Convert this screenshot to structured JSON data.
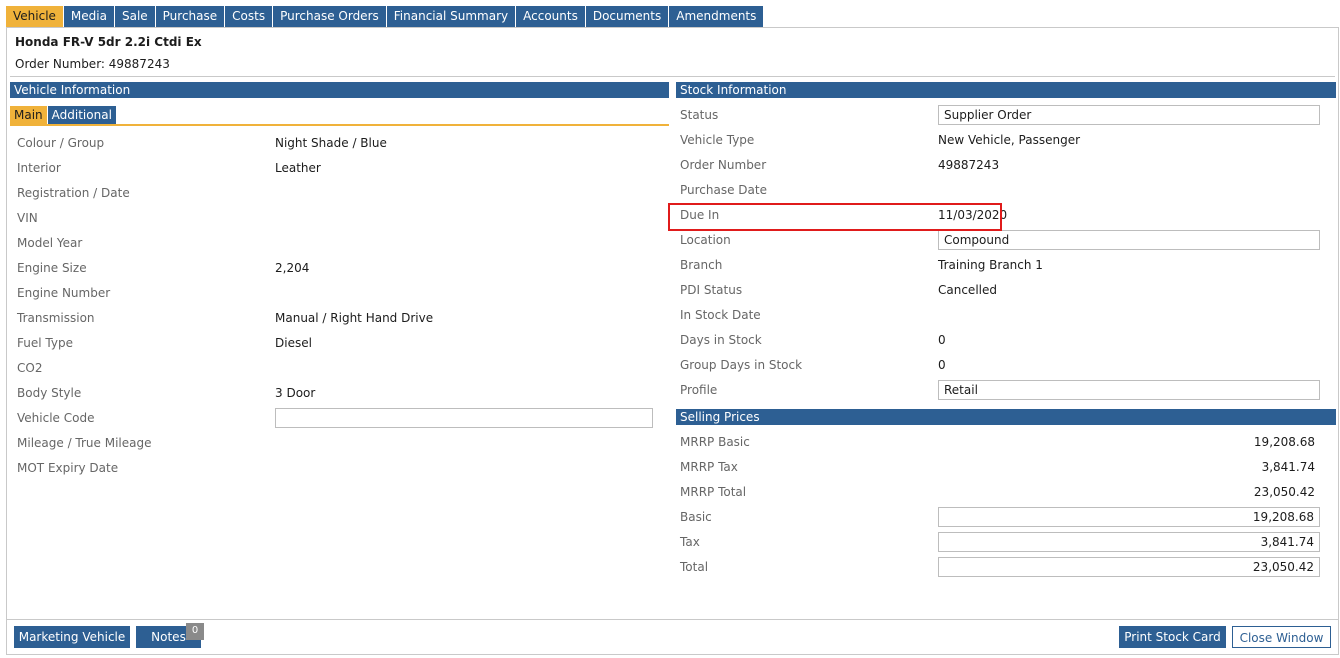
{
  "tabs": [
    {
      "label": "Vehicle",
      "active": true
    },
    {
      "label": "Media"
    },
    {
      "label": "Sale"
    },
    {
      "label": "Purchase"
    },
    {
      "label": "Costs"
    },
    {
      "label": "Purchase Orders"
    },
    {
      "label": "Financial Summary"
    },
    {
      "label": "Accounts"
    },
    {
      "label": "Documents"
    },
    {
      "label": "Amendments"
    }
  ],
  "header": {
    "vehicle_title": "Honda FR-V 5dr 2.2i Ctdi Ex",
    "order_number_text": "Order Number: 49887243"
  },
  "vehicle_info": {
    "title": "Vehicle Information",
    "subtabs": [
      {
        "label": "Main",
        "active": true
      },
      {
        "label": "Additional"
      }
    ],
    "fields": [
      {
        "label": "Colour / Group",
        "value": "Night Shade / Blue"
      },
      {
        "label": "Interior",
        "value": "Leather"
      },
      {
        "label": "Registration / Date",
        "value": ""
      },
      {
        "label": "VIN",
        "value": ""
      },
      {
        "label": "Model Year",
        "value": ""
      },
      {
        "label": "Engine Size",
        "value": "2,204"
      },
      {
        "label": "Engine Number",
        "value": ""
      },
      {
        "label": "Transmission",
        "value": "Manual / Right Hand Drive"
      },
      {
        "label": "Fuel Type",
        "value": "Diesel"
      },
      {
        "label": "CO2",
        "value": ""
      },
      {
        "label": "Body Style",
        "value": "3 Door"
      },
      {
        "label": "Vehicle Code",
        "value": ""
      },
      {
        "label": "Mileage / True Mileage",
        "value": ""
      },
      {
        "label": "MOT Expiry Date",
        "value": ""
      }
    ]
  },
  "stock_info": {
    "title": "Stock Information",
    "fields": [
      {
        "label": "Status",
        "value": "Supplier Order"
      },
      {
        "label": "Vehicle Type",
        "value": "New Vehicle, Passenger"
      },
      {
        "label": "Order Number",
        "value": "49887243"
      },
      {
        "label": "Purchase Date",
        "value": ""
      },
      {
        "label": "Due In",
        "value": "11/03/2020"
      },
      {
        "label": "Location",
        "value": "Compound"
      },
      {
        "label": "Branch",
        "value": "Training Branch 1"
      },
      {
        "label": "PDI Status",
        "value": "Cancelled"
      },
      {
        "label": "In Stock Date",
        "value": ""
      },
      {
        "label": "Days in Stock",
        "value": "0"
      },
      {
        "label": "Group Days in Stock",
        "value": "0"
      },
      {
        "label": "Profile",
        "value": "Retail"
      }
    ]
  },
  "selling_prices": {
    "title": "Selling Prices",
    "fields": [
      {
        "label": "MRRP Basic",
        "value": "19,208.68"
      },
      {
        "label": "MRRP Tax",
        "value": "3,841.74"
      },
      {
        "label": "MRRP Total",
        "value": "23,050.42"
      },
      {
        "label": "Basic",
        "value": "19,208.68"
      },
      {
        "label": "Tax",
        "value": "3,841.74"
      },
      {
        "label": "Total",
        "value": "23,050.42"
      }
    ]
  },
  "footer": {
    "marketing_label": "Marketing Vehicle",
    "notes_label": "Notes",
    "notes_count": "0",
    "print_label": "Print Stock Card",
    "close_label": "Close Window"
  },
  "colors": {
    "primary": "#2d5f93",
    "active_tab": "#f0b23a",
    "highlight": "#e01b1b"
  }
}
